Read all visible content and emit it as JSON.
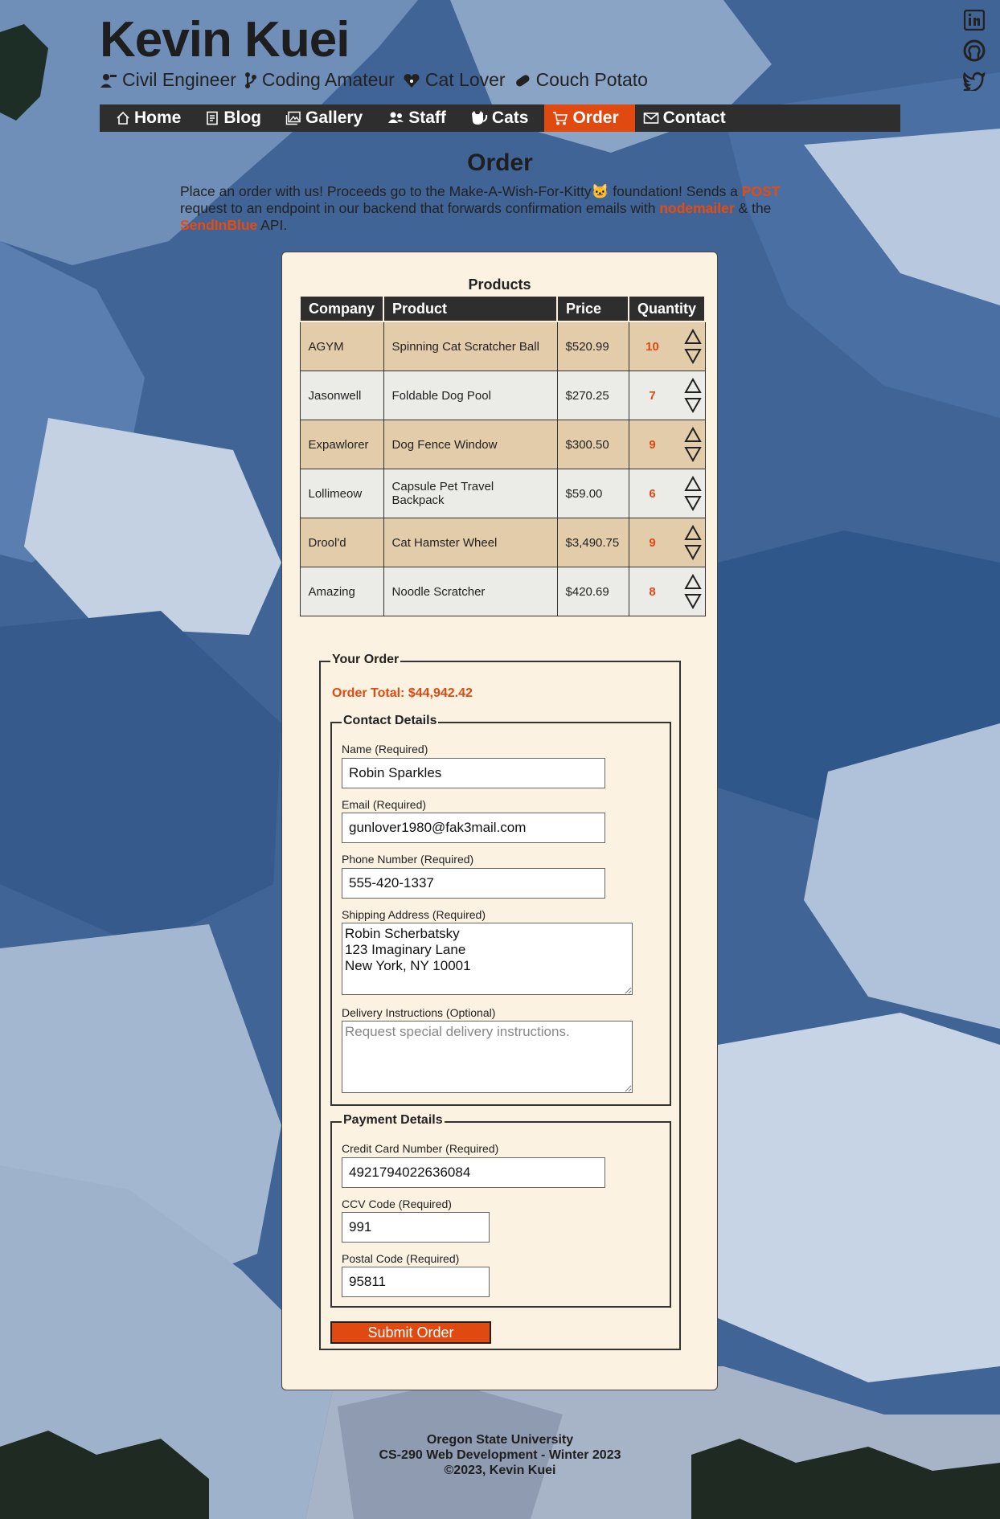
{
  "header": {
    "title": "Kevin Kuei",
    "tags": [
      {
        "icon": "engineer-icon",
        "label": "Civil Engineer"
      },
      {
        "icon": "branch-icon",
        "label": "Coding Amateur"
      },
      {
        "icon": "heart-paw-icon",
        "label": "Cat Lover"
      },
      {
        "icon": "pill-icon",
        "label": "Couch Potato"
      }
    ]
  },
  "nav": {
    "items": [
      {
        "icon": "home-icon",
        "label": "Home"
      },
      {
        "icon": "document-icon",
        "label": "Blog"
      },
      {
        "icon": "gallery-icon",
        "label": "Gallery"
      },
      {
        "icon": "people-icon",
        "label": "Staff"
      },
      {
        "icon": "cat-icon",
        "label": "Cats"
      },
      {
        "icon": "cart-icon",
        "label": "Order"
      },
      {
        "icon": "mail-icon",
        "label": "Contact"
      }
    ],
    "active": "Order"
  },
  "social": [
    "linkedin-icon",
    "github-icon",
    "twitter-icon"
  ],
  "page": {
    "heading": "Order",
    "intro_1": "Place an order with us! Proceeds go to the Make-A-Wish-For-Kitty🐱 foundation! Sends a ",
    "intro_post": "POST",
    "intro_2": " request to an endpoint in our backend that forwards confirmation emails with ",
    "intro_nodemailer": "nodemailer",
    "intro_3": " & the ",
    "intro_sendinblue": "SendInBlue",
    "intro_4": " API."
  },
  "products": {
    "caption": "Products",
    "headers": [
      "Company",
      "Product",
      "Price",
      "Quantity"
    ],
    "rows": [
      {
        "company": "AGYM",
        "product": "Spinning Cat Scratcher Ball",
        "price": "$520.99",
        "quantity": "10"
      },
      {
        "company": "Jasonwell",
        "product": "Foldable Dog Pool",
        "price": "$270.25",
        "quantity": "7"
      },
      {
        "company": "Expawlorer",
        "product": "Dog Fence Window",
        "price": "$300.50",
        "quantity": "9"
      },
      {
        "company": "Lollimeow",
        "product": "Capsule Pet Travel Backpack",
        "price": "$59.00",
        "quantity": "6"
      },
      {
        "company": "Drool'd",
        "product": "Cat Hamster Wheel",
        "price": "$3,490.75",
        "quantity": "9"
      },
      {
        "company": "Amazing",
        "product": "Noodle Scratcher",
        "price": "$420.69",
        "quantity": "8"
      }
    ]
  },
  "order": {
    "legend": "Your Order",
    "total": "Order Total: $44,942.42",
    "contact": {
      "legend": "Contact Details",
      "name_label": "Name (Required)",
      "name_value": "Robin Sparkles",
      "email_label": "Email (Required)",
      "email_value": "gunlover1980@fak3mail.com",
      "phone_label": "Phone Number (Required)",
      "phone_value": "555-420-1337",
      "address_label": "Shipping Address (Required)",
      "address_value": "Robin Scherbatsky\n123 Imaginary Lane\nNew York, NY 10001",
      "instructions_label": "Delivery Instructions (Optional)",
      "instructions_placeholder": "Request special delivery instructions."
    },
    "payment": {
      "legend": "Payment Details",
      "card_label": "Credit Card Number (Required)",
      "card_value": "4921794022636084",
      "ccv_label": "CCV Code (Required)",
      "ccv_value": "991",
      "postal_label": "Postal Code (Required)",
      "postal_value": "95811"
    },
    "submit_label": "Submit Order"
  },
  "footer": {
    "line1": "Oregon State University",
    "line2": "CS-290 Web Development - Winter 2023",
    "line3": "©2023, Kevin Kuei"
  },
  "colors": {
    "accent": "#e04a10",
    "nav_bg": "#2e2e2e",
    "card_bg": "#fcf2e2",
    "row_tan": "#e3ccaa",
    "row_gray": "#ebebe7"
  }
}
